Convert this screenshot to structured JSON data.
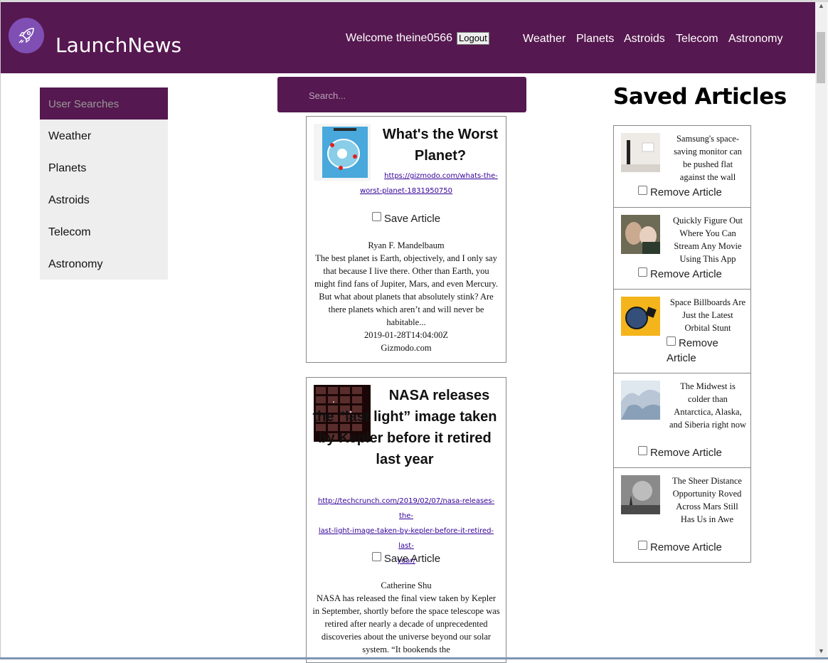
{
  "header": {
    "brand": "LaunchNews",
    "welcome": "Welcome theine0566",
    "logout_label": "Logout",
    "nav": [
      "Weather",
      "Planets",
      "Astroids",
      "Telecom",
      "Astronomy"
    ]
  },
  "sidebar": {
    "heading": "User Searches",
    "items": [
      "Weather",
      "Planets",
      "Astroids",
      "Telecom",
      "Astronomy"
    ]
  },
  "search": {
    "placeholder": "Search..."
  },
  "articles": [
    {
      "title": "What's the Worst Planet?",
      "url": "https://gizmodo.com/whats-the-worst-planet-1831950750",
      "url_lines": [
        "https://gizmodo.com/whats-the-",
        "worst-planet-1831950750"
      ],
      "save_label": "Save Article",
      "author": "Ryan F. Mandelbaum",
      "description": "The best planet is Earth, objectively, and I only say that because I live there. Other than Earth, you might find fans of Jupiter, Mars, and even Mercury. But what about planets that absolutely stink? Are there planets which aren’t and will never be habitable...",
      "published": "2019-01-28T14:04:00Z",
      "source": "Gizmodo.com"
    },
    {
      "title": "NASA releases the “last light” image taken by Kepler before it retired last year",
      "url": "http://techcrunch.com/2019/02/07/nasa-releases-the-last-light-image-taken-by-kepler-before-it-retired-last-year/",
      "url_lines": [
        "http://techcrunch.com/2019/02/07/nasa-releases-the-",
        "last-light-image-taken-by-kepler-before-it-retired-last-",
        "year/"
      ],
      "save_label": "Save Article",
      "author": "Catherine Shu",
      "description": "NASA has released the final view taken by Kepler in September, shortly before the space telescope was retired after nearly a decade of unprecedented discoveries about the universe beyond our solar system. “It bookends the"
    }
  ],
  "saved": {
    "heading": "Saved Articles",
    "remove_label": "Remove Article",
    "items": [
      {
        "title": "Samsung's space-saving monitor can be pushed flat against the wall"
      },
      {
        "title": "Quickly Figure Out Where You Can Stream Any Movie Using This App"
      },
      {
        "title": "Space Billboards Are Just the Latest Orbital Stunt"
      },
      {
        "title": "The Midwest is colder than Antarctica, Alaska, and Siberia right now"
      },
      {
        "title": "The Sheer Distance Opportunity Roved Across Mars Still Has Us in Awe"
      }
    ]
  },
  "colors": {
    "brand_purple": "#561850",
    "logo_circle": "#7f4fb4",
    "sidebar_bg": "#eeeeee",
    "link": "#330099"
  },
  "icons": [
    "rocket-icon",
    "scroll-up-arrow-icon",
    "scroll-down-arrow-icon"
  ]
}
